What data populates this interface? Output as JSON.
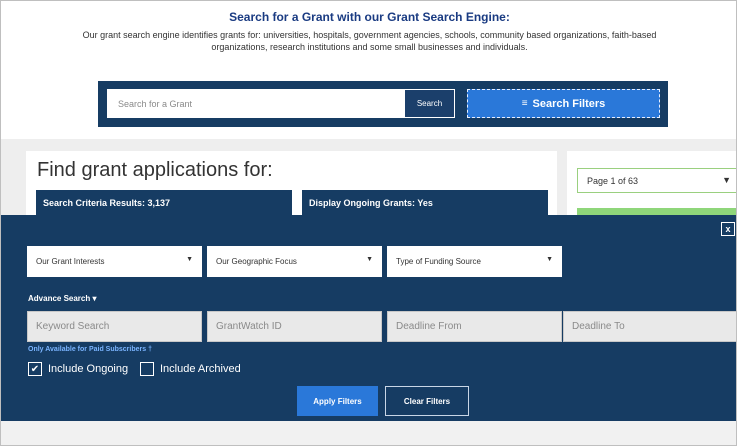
{
  "header": {
    "title": "Search for a Grant with our Grant Search Engine:",
    "description": "Our grant search engine identifies grants for: universities, hospitals, government agencies, schools, community based organizations, faith-based organizations, research institutions and some small businesses and individuals."
  },
  "search": {
    "placeholder": "Search for a Grant",
    "button_label": "Search",
    "filters_label": "Search Filters",
    "filters_icon": "sliders-icon"
  },
  "results": {
    "heading": "Find grant applications for:",
    "criteria": "Search Criteria Results: 3,137",
    "ongoing": "Display Ongoing Grants: Yes",
    "page_select": "Page 1 of 63"
  },
  "filters": {
    "close": "x",
    "selects": [
      "Our Grant Interests",
      "Our Geographic Focus",
      "Type of Funding Source"
    ],
    "advance_search": "Advance Search ▾",
    "fields": [
      "Keyword Search",
      "GrantWatch ID",
      "Deadline From",
      "Deadline To"
    ],
    "paid_note": "Only Available for Paid Subscribers †",
    "include_ongoing": {
      "label": "Include Ongoing",
      "checked": true
    },
    "include_archived": {
      "label": "Include Archived",
      "checked": false
    },
    "apply_label": "Apply Filters",
    "clear_label": "Clear Filters"
  },
  "colors": {
    "navy": "#163c63",
    "accent_blue": "#2a78d9",
    "title_blue": "#1a3b82",
    "green": "#8fd67a"
  }
}
